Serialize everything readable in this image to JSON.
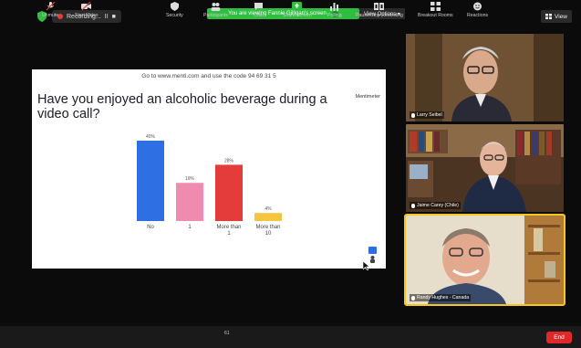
{
  "topbar": {
    "recording_label": "Recording...",
    "pause_glyph": "II",
    "stop_glyph": "■",
    "banner_text": "You are viewing Fannie Gilligan's screen",
    "view_options_label": "View Options ▾",
    "view_label": "View"
  },
  "slide": {
    "code_line": "Go to www.menti.com and use the code 94 69 31 5",
    "question": "Have you enjoyed an alcoholic beverage during a video call?",
    "brand": "Mentimeter"
  },
  "chart_data": {
    "type": "bar",
    "categories": [
      "No",
      "1",
      "More than 1",
      "More than 10"
    ],
    "values": [
      40,
      19,
      28,
      4
    ],
    "value_labels": [
      "40%",
      "19%",
      "28%",
      "4%"
    ],
    "colors": [
      "#2f6fe4",
      "#f08bb0",
      "#e43b3b",
      "#f5c542"
    ],
    "ylim": [
      0,
      40
    ]
  },
  "participants": [
    {
      "name": "Larry Seibel"
    },
    {
      "name": "Jaime Carey (Chile)"
    },
    {
      "name": "Randy Hughes - Canada"
    }
  ],
  "toolbar": {
    "items": [
      {
        "label": "Unmute",
        "icon": "mic-muted-icon"
      },
      {
        "label": "Start Video",
        "icon": "video-off-icon"
      },
      {
        "label": "Security",
        "icon": "shield-icon"
      },
      {
        "label": "Participants",
        "icon": "participants-icon",
        "count": "61"
      },
      {
        "label": "Chat",
        "icon": "chat-icon"
      },
      {
        "label": "Share Screen",
        "icon": "share-screen-icon"
      },
      {
        "label": "Polling",
        "icon": "polling-icon"
      },
      {
        "label": "Pause/Stop Recording",
        "icon": "recording-icon"
      },
      {
        "label": "Breakout Rooms",
        "icon": "breakout-icon"
      },
      {
        "label": "Reactions",
        "icon": "reactions-icon"
      }
    ],
    "end_label": "End"
  },
  "colors": {
    "share_green": "#2fbf3f",
    "end_red": "#e02828",
    "active_speaker": "#f4c622"
  }
}
